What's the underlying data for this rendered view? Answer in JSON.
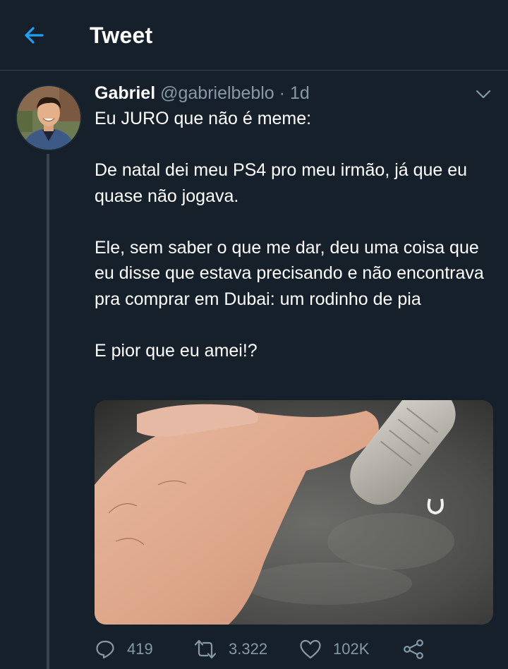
{
  "header": {
    "title": "Tweet",
    "accent_color": "#1da1f2"
  },
  "tweet": {
    "author_name": "Gabriel",
    "handle": "@gabrielbeblo",
    "separator": "·",
    "time": "1d",
    "text": "Eu JURO que não é meme:\n\nDe natal dei meu PS4 pro meu irmão, já que eu quase não jogava.\n\nEle, sem saber o que me dar, deu uma coisa que eu disse que estava precisando e não encontrava pra comprar em Dubai: um rodinho de pia\n\nE pior que eu amei!?",
    "actions": {
      "replies": "419",
      "retweets": "3.322",
      "likes": "102K"
    }
  },
  "icons": {
    "back": "arrow-left-icon",
    "more": "chevron-down-icon",
    "reply": "reply-icon",
    "retweet": "retweet-icon",
    "like": "heart-icon",
    "share": "share-icon"
  },
  "colors": {
    "background": "#15202b",
    "secondary_text": "#8899a6",
    "divider": "#38444d"
  }
}
